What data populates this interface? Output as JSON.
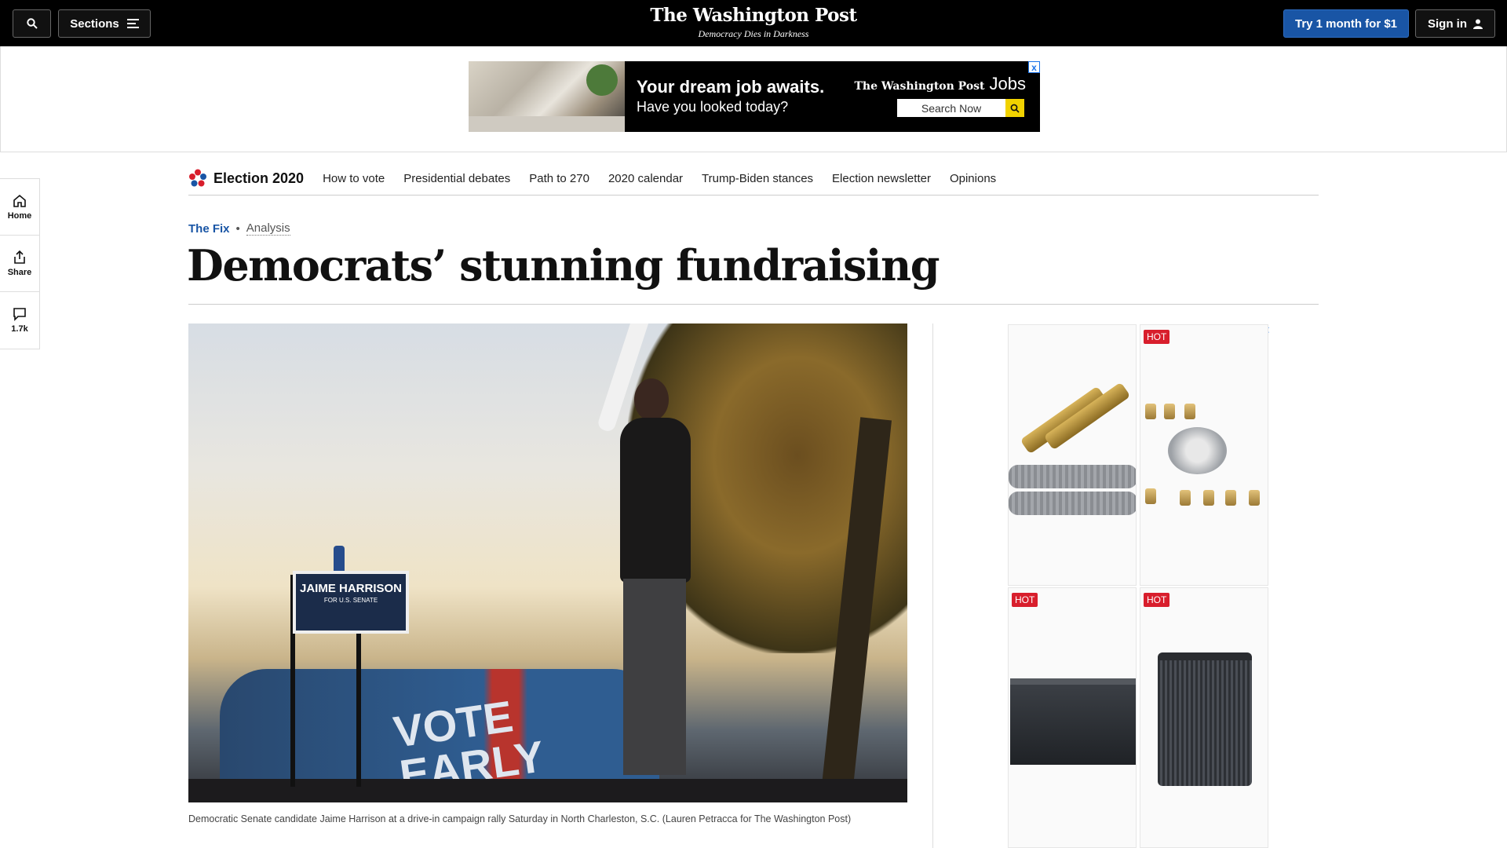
{
  "topbar": {
    "sections_label": "Sections",
    "logo": "The Washington Post",
    "tagline": "Democracy Dies in Darkness",
    "try_label": "Try 1 month for $1",
    "signin_label": "Sign in"
  },
  "banner_ad": {
    "headline": "Your dream job awaits.",
    "subline": "Have you looked today?",
    "brand": "The Washington Post",
    "brand_suffix": "Jobs",
    "search_label": "Search Now",
    "close_glyph": "x"
  },
  "left_rail": {
    "items": [
      {
        "label": "Home",
        "icon": "home-icon"
      },
      {
        "label": "Share",
        "icon": "share-icon"
      },
      {
        "label": "1.7k",
        "icon": "comment-icon"
      }
    ]
  },
  "election_nav": {
    "brand": "Election 2020",
    "links": [
      "How to vote",
      "Presidential debates",
      "Path to 270",
      "2020 calendar",
      "Trump-Biden stances",
      "Election newsletter",
      "Opinions"
    ]
  },
  "article": {
    "section": "The Fix",
    "separator": "•",
    "label": "Analysis",
    "headline": "Democrats’ stunning fundraising",
    "photo": {
      "sign_line1": "JAIME HARRISON",
      "sign_line2": "FOR U.S. SENATE",
      "van_text_1": "VOTE",
      "van_text_2": "EARLY"
    },
    "caption": "Democratic Senate candidate Jaime Harrison at a drive-in campaign rally Saturday in North Charleston, S.C. (Lauren Petracca for The Washington Post)"
  },
  "side_ad": {
    "badge": "HOT",
    "adchoice_glyph": "▷",
    "close_glyph": "✕"
  },
  "colors": {
    "accent_blue": "#1955a5",
    "hot_red": "#d81e2c",
    "masthead_bg": "#000000"
  }
}
